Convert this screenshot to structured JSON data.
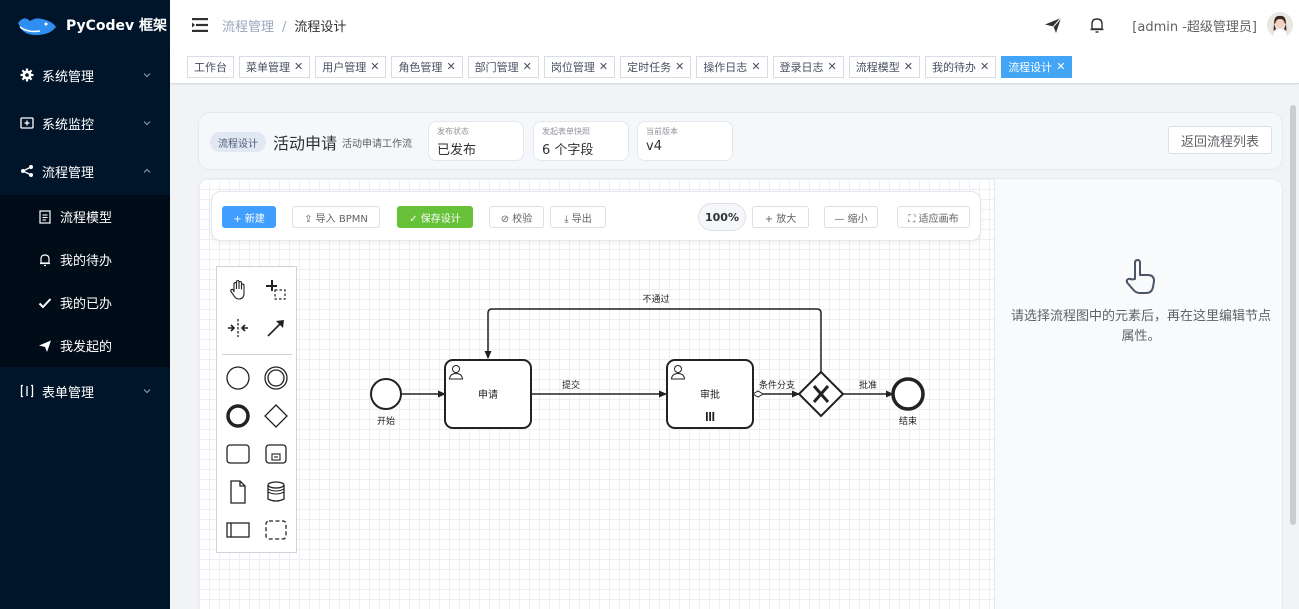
{
  "app": {
    "name": "PyCodev 框架"
  },
  "sidebar": {
    "items": [
      {
        "label": "系统管理",
        "icon": "gear-icon"
      },
      {
        "label": "系统监控",
        "icon": "monitor-icon"
      },
      {
        "label": "流程管理",
        "icon": "share-icon"
      },
      {
        "label": "表单管理",
        "icon": "form-icon"
      }
    ],
    "sub_items": [
      {
        "label": "流程模型",
        "icon": "document-icon"
      },
      {
        "label": "我的待办",
        "icon": "bell-icon"
      },
      {
        "label": "我的已办",
        "icon": "check-icon"
      },
      {
        "label": "我发起的",
        "icon": "send-icon"
      }
    ]
  },
  "header": {
    "breadcrumb": [
      "流程管理",
      "流程设计"
    ],
    "user": "[admin -超级管理员]"
  },
  "tags": [
    {
      "label": "工作台",
      "closable": false
    },
    {
      "label": "菜单管理",
      "closable": true
    },
    {
      "label": "用户管理",
      "closable": true
    },
    {
      "label": "角色管理",
      "closable": true
    },
    {
      "label": "部门管理",
      "closable": true
    },
    {
      "label": "岗位管理",
      "closable": true
    },
    {
      "label": "定时任务",
      "closable": true
    },
    {
      "label": "操作日志",
      "closable": true
    },
    {
      "label": "登录日志",
      "closable": true
    },
    {
      "label": "流程模型",
      "closable": true
    },
    {
      "label": "我的待办",
      "closable": true
    },
    {
      "label": "流程设计",
      "closable": true,
      "active": true
    }
  ],
  "design": {
    "tag": "流程设计",
    "title": "活动申请",
    "subtitle": "活动申请工作流",
    "meta": [
      {
        "label": "发布状态",
        "value": "已发布"
      },
      {
        "label": "发起表单快照",
        "value": "6 个字段"
      },
      {
        "label": "当前版本",
        "value": "v4"
      }
    ],
    "back_label": "返回流程列表"
  },
  "toolbar": {
    "new": "+ 新建",
    "import": "⇪ 导入 BPMN",
    "save": "✓ 保存设计",
    "validate": "⊘ 校验",
    "export": "⤓ 导出",
    "zoom": "100%",
    "zoom_in": "+ 放大",
    "zoom_out": "— 缩小",
    "fit": "⛶ 适应画布"
  },
  "diagram": {
    "start": "开始",
    "task1": "申请",
    "edge1": "提交",
    "task2": "审批",
    "edge2": "条件分支",
    "edge3": "批准",
    "end": "结束",
    "reject": "不通过"
  },
  "props": {
    "hint": "请选择流程图中的元素后，再在这里编辑节点属性。"
  },
  "colors": {
    "sidebar": "#001529",
    "primary": "#409eff",
    "success": "#67c23a",
    "active_tag": "#42a5f5"
  }
}
